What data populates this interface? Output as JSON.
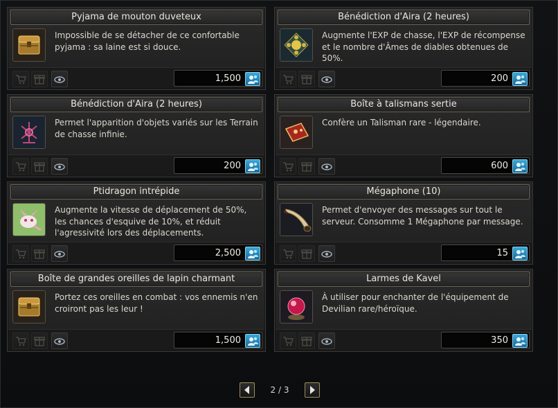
{
  "items": [
    {
      "title": "Pyjama de mouton duveteux",
      "description": "Impossible de se détacher de ce confortable pyjama : sa laine est si douce.",
      "price": "1,500",
      "icon": "treasure-chest-icon"
    },
    {
      "title": "Bénédiction d'Aira (2 heures)",
      "description": "Augmente l'EXP de chasse, l'EXP de récompense et le nombre d'Âmes de diables obtenues de 50%.",
      "price": "200",
      "icon": "golden-emblem-icon"
    },
    {
      "title": "Bénédiction d'Aira (2 heures)",
      "description": "Permet l'apparition d'objets variés sur les Terrain de chasse infinie.",
      "price": "200",
      "icon": "magic-rune-icon"
    },
    {
      "title": "Boîte à talismans sertie",
      "description": "Confère un Talisman rare - légendaire.",
      "price": "600",
      "icon": "talisman-box-icon"
    },
    {
      "title": "Ptidragon intrépide",
      "description": "Augmente la vitesse de déplacement de 50%, les chances d'esquive de 10%, et réduit l'agressivité lors des déplacements.",
      "price": "2,500",
      "icon": "dragon-pet-icon"
    },
    {
      "title": "Mégaphone (10)",
      "description": "Permet d'envoyer des messages sur tout le serveur. Consomme 1 Mégaphone par message.",
      "price": "15",
      "icon": "megaphone-horn-icon"
    },
    {
      "title": "Boîte de grandes oreilles de lapin charmant",
      "description": "Portez ces oreilles en combat : vos ennemis n'en croiront pas les leur !",
      "price": "1,500",
      "icon": "treasure-chest-icon"
    },
    {
      "title": "Larmes de Kavel",
      "description": "À utiliser pour enchanter de l'équipement de Devilian rare/héroïque.",
      "price": "350",
      "icon": "red-orb-icon"
    }
  ],
  "pagination": {
    "label": "2 / 3"
  },
  "colors": {
    "accent_gold": "#9f8f5a",
    "coin_blue": "#3aa7d6"
  }
}
